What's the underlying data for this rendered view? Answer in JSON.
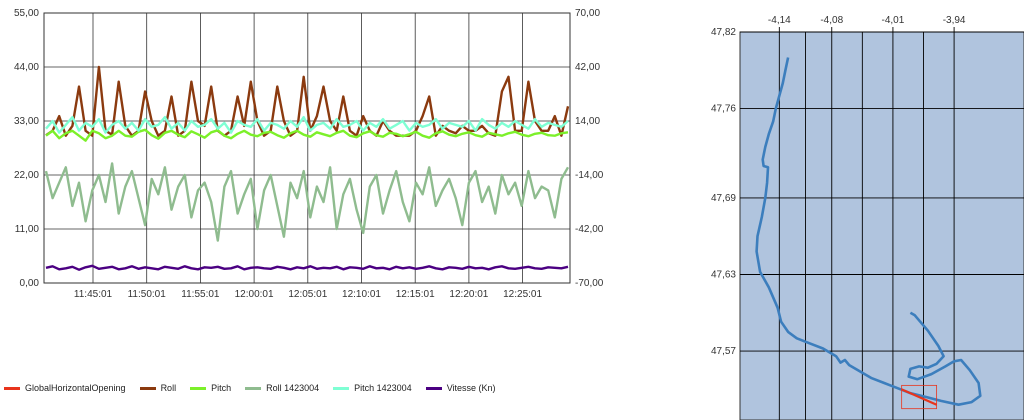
{
  "chart_data": [
    {
      "type": "line",
      "title": "",
      "xlabel": "",
      "ylabel": "",
      "x_ticks": [
        "11:45:01",
        "11:50:01",
        "11:55:01",
        "12:00:01",
        "12:05:01",
        "12:10:01",
        "12:15:01",
        "12:20:01",
        "12:25:01"
      ],
      "y_left_ticks": [
        "0,00",
        "11,00",
        "22,00",
        "33,00",
        "44,00",
        "55,00"
      ],
      "y_right_ticks": [
        "-70,00",
        "-42,00",
        "-14,00",
        "14,00",
        "42,00",
        "70,00"
      ],
      "ylim_left": [
        0,
        55
      ],
      "ylim_right": [
        -70,
        70
      ],
      "grid": true,
      "legend_position": "bottom",
      "series": [
        {
          "name": "GlobalHorizontalOpening",
          "color": "#e8341c",
          "values": []
        },
        {
          "name": "Roll",
          "color": "#8b3a0f",
          "axis": "left",
          "approx_range": [
            29,
            46
          ],
          "values": [
            30.1,
            31.0,
            34.0,
            30.0,
            32.0,
            40.0,
            31.0,
            30.0,
            44.0,
            31.0,
            30.2,
            41.0,
            32.0,
            30.0,
            31.0,
            39.0,
            33.0,
            30.0,
            31.0,
            38.0,
            30.0,
            31.0,
            41.0,
            33.0,
            32.0,
            40.0,
            31.0,
            30.0,
            31.0,
            38.0,
            32.0,
            41.0,
            33.0,
            30.0,
            31.0,
            40.0,
            33.0,
            30.0,
            31.0,
            42.0,
            31.0,
            34.0,
            40.0,
            33.0,
            31.0,
            38.0,
            31.0,
            30.0,
            34.0,
            31.0,
            30.0,
            33.0,
            31.0,
            30.0,
            30.0,
            30.0,
            31.0,
            34.0,
            38.0,
            30.0,
            32.0,
            31.0,
            30.5,
            32.0,
            31.0,
            31.0,
            32.0,
            30.5,
            30.0,
            39.0,
            42.0,
            31.0,
            31.0,
            41.0,
            33.0,
            31.0,
            31.0,
            34.0,
            30.0,
            36.0
          ]
        },
        {
          "name": "Pitch",
          "color": "#7cf02a",
          "axis": "left",
          "approx_range": [
            28,
            33
          ],
          "values": [
            30.0,
            31.0,
            29.5,
            30.5,
            31.0,
            30.0,
            29.0,
            31.0,
            30.5,
            29.5,
            30.0,
            31.0,
            30.0,
            29.8,
            30.8,
            31.2,
            30.1,
            29.4,
            30.6,
            31.0,
            30.2,
            29.7,
            30.9,
            30.3,
            29.6,
            30.7,
            31.1,
            30.0,
            29.5,
            30.4,
            31.0,
            30.2,
            29.9,
            30.6,
            30.8,
            30.1,
            29.6,
            30.5,
            31.0,
            30.2,
            29.8,
            30.7,
            30.3,
            29.9,
            30.6,
            31.0,
            30.0,
            29.7,
            30.5,
            30.9,
            30.1,
            29.8,
            30.6,
            30.4,
            29.9,
            30.3,
            30.8,
            30.0,
            29.6,
            30.5,
            30.9,
            30.2,
            29.9,
            30.4,
            30.7,
            30.1,
            29.8,
            30.6,
            30.3,
            30.0,
            30.5,
            30.8,
            30.2,
            29.9,
            30.4,
            30.6,
            30.1,
            30.0,
            30.5,
            30.7
          ]
        },
        {
          "name": "Roll 1423004",
          "color": "#8fbc8f",
          "axis": "right",
          "approx_range": [
            -55,
            0
          ],
          "values": [
            -12,
            -26,
            -18,
            -10,
            -30,
            -18,
            -38,
            -22,
            -14,
            -28,
            -8,
            -34,
            -20,
            -12,
            -26,
            -40,
            -16,
            -24,
            -10,
            -32,
            -20,
            -14,
            -36,
            -22,
            -18,
            -28,
            -48,
            -20,
            -12,
            -34,
            -24,
            -16,
            -42,
            -22,
            -14,
            -30,
            -46,
            -18,
            -26,
            -12,
            -36,
            -20,
            -28,
            -10,
            -42,
            -24,
            -16,
            -32,
            -44,
            -20,
            -14,
            -34,
            -22,
            -12,
            -28,
            -38,
            -18,
            -24,
            -10,
            -30,
            -22,
            -16,
            -26,
            -40,
            -18,
            -12,
            -28,
            -20,
            -34,
            -14,
            -24,
            -18,
            -30,
            -12,
            -26,
            -20,
            -22,
            -36,
            -16,
            -10
          ]
        },
        {
          "name": "Pitch 1423004",
          "color": "#7fffd4",
          "axis": "right",
          "approx_range": [
            5,
            18
          ],
          "values": [
            10,
            14,
            8,
            12,
            16,
            9,
            13,
            11,
            15,
            8,
            12,
            14,
            10,
            13,
            9,
            15,
            11,
            12,
            16,
            10,
            13,
            9,
            14,
            11,
            12,
            15,
            10,
            13,
            8,
            14,
            12,
            11,
            15,
            9,
            13,
            12,
            10,
            14,
            11,
            16,
            9,
            12,
            13,
            10,
            15,
            11,
            12,
            14,
            9,
            13,
            11,
            15,
            10,
            12,
            14,
            9,
            13,
            11,
            12,
            15,
            10,
            13,
            12,
            11,
            14,
            9,
            15,
            12,
            10,
            13,
            11,
            14,
            12,
            10,
            15,
            11,
            13,
            12,
            11,
            14
          ]
        },
        {
          "name": "Vitesse (Kn)",
          "color": "#4b0082",
          "axis": "left",
          "approx_range": [
            2.3,
            4.0
          ],
          "values": [
            3.1,
            3.4,
            2.8,
            3.0,
            3.3,
            2.7,
            3.2,
            3.5,
            2.9,
            3.1,
            3.3,
            2.8,
            3.0,
            3.4,
            2.9,
            3.2,
            3.0,
            2.8,
            3.3,
            3.1,
            2.9,
            3.4,
            3.0,
            2.8,
            3.2,
            3.1,
            3.3,
            2.9,
            3.0,
            3.4,
            2.8,
            3.1,
            3.2,
            3.0,
            2.9,
            3.3,
            3.1,
            2.8,
            3.2,
            3.0,
            3.4,
            2.9,
            3.1,
            3.0,
            3.3,
            2.8,
            3.2,
            3.1,
            2.9,
            3.4,
            3.0,
            3.1,
            2.8,
            3.3,
            3.0,
            3.2,
            2.9,
            3.1,
            3.4,
            3.0,
            2.8,
            3.2,
            3.1,
            2.9,
            3.3,
            3.0,
            3.1,
            2.8,
            3.2,
            3.4,
            3.0,
            2.9,
            3.1,
            3.3,
            3.0,
            2.9,
            3.2,
            3.1,
            3.0,
            3.3
          ]
        }
      ]
    },
    {
      "type": "line",
      "title": "",
      "xlabel": "",
      "ylabel": "",
      "x_ticks": [
        "-4,14",
        "-4,08",
        "-4,01",
        "-3,94"
      ],
      "y_ticks": [
        "47,82",
        "47,76",
        "47,69",
        "47,63",
        "47,57"
      ],
      "xlim": [
        -4.185,
        -3.86
      ],
      "ylim": [
        47.516,
        47.82
      ],
      "background": "#b0c4de",
      "grid": true,
      "series": [
        {
          "name": "track",
          "color": "#3c7ebd",
          "points": [
            [
              -4.13,
              47.8
            ],
            [
              -4.133,
              47.79
            ],
            [
              -4.136,
              47.78
            ],
            [
              -4.14,
              47.77
            ],
            [
              -4.144,
              47.76
            ],
            [
              -4.147,
              47.75
            ],
            [
              -4.152,
              47.74
            ],
            [
              -4.156,
              47.73
            ],
            [
              -4.159,
              47.72
            ],
            [
              -4.158,
              47.715
            ],
            [
              -4.153,
              47.714
            ],
            [
              -4.154,
              47.702
            ],
            [
              -4.156,
              47.69
            ],
            [
              -4.16,
              47.675
            ],
            [
              -4.165,
              47.66
            ],
            [
              -4.166,
              47.648
            ],
            [
              -4.162,
              47.632
            ],
            [
              -4.152,
              47.62
            ],
            [
              -4.142,
              47.604
            ],
            [
              -4.138,
              47.593
            ],
            [
              -4.13,
              47.585
            ],
            [
              -4.12,
              47.58
            ],
            [
              -4.105,
              47.576
            ],
            [
              -4.09,
              47.572
            ],
            [
              -4.075,
              47.566
            ],
            [
              -4.07,
              47.561
            ],
            [
              -4.065,
              47.563
            ],
            [
              -4.06,
              47.559
            ],
            [
              -4.05,
              47.555
            ],
            [
              -4.035,
              47.549
            ],
            [
              -4.02,
              47.545
            ],
            [
              -4.005,
              47.541
            ],
            [
              -3.99,
              47.537
            ],
            [
              -3.972,
              47.534
            ],
            [
              -3.955,
              47.531
            ],
            [
              -3.935,
              47.528
            ],
            [
              -3.92,
              47.53
            ],
            [
              -3.91,
              47.535
            ],
            [
              -3.912,
              47.545
            ],
            [
              -3.922,
              47.555
            ],
            [
              -3.932,
              47.563
            ],
            [
              -3.94,
              47.562
            ],
            [
              -3.95,
              47.558
            ],
            [
              -3.966,
              47.552
            ],
            [
              -3.982,
              47.548
            ],
            [
              -3.992,
              47.55
            ],
            [
              -3.99,
              47.556
            ],
            [
              -3.98,
              47.558
            ],
            [
              -3.97,
              47.557
            ],
            [
              -3.96,
              47.56
            ],
            [
              -3.952,
              47.566
            ],
            [
              -3.958,
              47.574
            ],
            [
              -3.97,
              47.586
            ],
            [
              -3.985,
              47.598
            ],
            [
              -3.99,
              47.6
            ]
          ]
        },
        {
          "name": "selection",
          "color": "#e8341c",
          "points": [
            [
              -4.0,
              47.54
            ],
            [
              -3.96,
              47.528
            ]
          ]
        }
      ]
    }
  ],
  "legend": [
    {
      "label": "GlobalHorizontalOpening",
      "color": "#e8341c"
    },
    {
      "label": "Roll",
      "color": "#8b3a0f"
    },
    {
      "label": "Pitch",
      "color": "#7cf02a"
    },
    {
      "label": "Roll 1423004",
      "color": "#8fbc8f"
    },
    {
      "label": "Pitch 1423004",
      "color": "#7fffd4"
    },
    {
      "label": "Vitesse (Kn)",
      "color": "#4b0082"
    }
  ]
}
